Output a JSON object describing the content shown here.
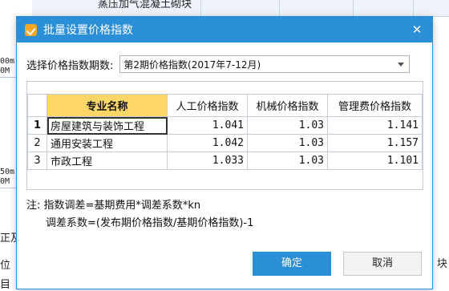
{
  "background": {
    "top_row_text": "蒸压加气混凝土砌块",
    "left_labels": [
      "00m",
      "0M",
      "50m",
      "0M"
    ],
    "left_texts": [
      "正及",
      "位",
      "目"
    ],
    "right_text": "块"
  },
  "dialog": {
    "title": "批量设置价格指数",
    "close_symbol": "✕",
    "period_label": "选择价格指数期数:",
    "period_value": "第2期价格指数(2017年7-12月)",
    "table": {
      "headers": [
        "",
        "专业名称",
        "人工价格指数",
        "机械价格指数",
        "管理费价格指数"
      ],
      "rows": [
        {
          "idx": "1",
          "name": "房屋建筑与装饰工程",
          "labor": "1.041",
          "machine": "1.03",
          "mgmt": "1.141"
        },
        {
          "idx": "2",
          "name": "通用安装工程",
          "labor": "1.042",
          "machine": "1.03",
          "mgmt": "1.157"
        },
        {
          "idx": "3",
          "name": "市政工程",
          "labor": "1.033",
          "machine": "1.03",
          "mgmt": "1.101"
        }
      ]
    },
    "note_line1": "注: 指数调差=基期费用*调差系数*kn",
    "note_line2": "调差系数=(发布期价格指数/基期价格指数)-1",
    "ok_label": "确定",
    "cancel_label": "取消"
  },
  "colors": {
    "accent": "#2a8fd7",
    "header_highlight": "#fcd768"
  }
}
